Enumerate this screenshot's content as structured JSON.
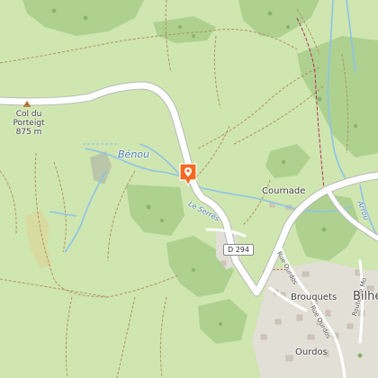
{
  "map": {
    "labels": {
      "col_name": "Col du",
      "col_name2": "Porteigt",
      "col_elevation": "875 m",
      "river": "Bénou",
      "stream": "Le Serrès",
      "hamlet": "Cournade",
      "road_ref": "D 294",
      "street_1": "Rue Ourdos",
      "street_2": "Rue Ourdos",
      "street_3": "Route de Mo",
      "quarter_1": "Brouquets",
      "quarter_2": "Ourdos",
      "town": "Bilhe",
      "river_edge": "Arrou"
    },
    "marker": {
      "icon": "location-pin-icon",
      "color": "#f26a21"
    },
    "colors": {
      "meadow": "#cfe6b0",
      "forest": "#aed190",
      "road": "#ffffff",
      "road_casing": "#b9b9b9",
      "water": "#8ec3e8",
      "track": "#b5915f",
      "boundary": "#b0305e"
    }
  }
}
